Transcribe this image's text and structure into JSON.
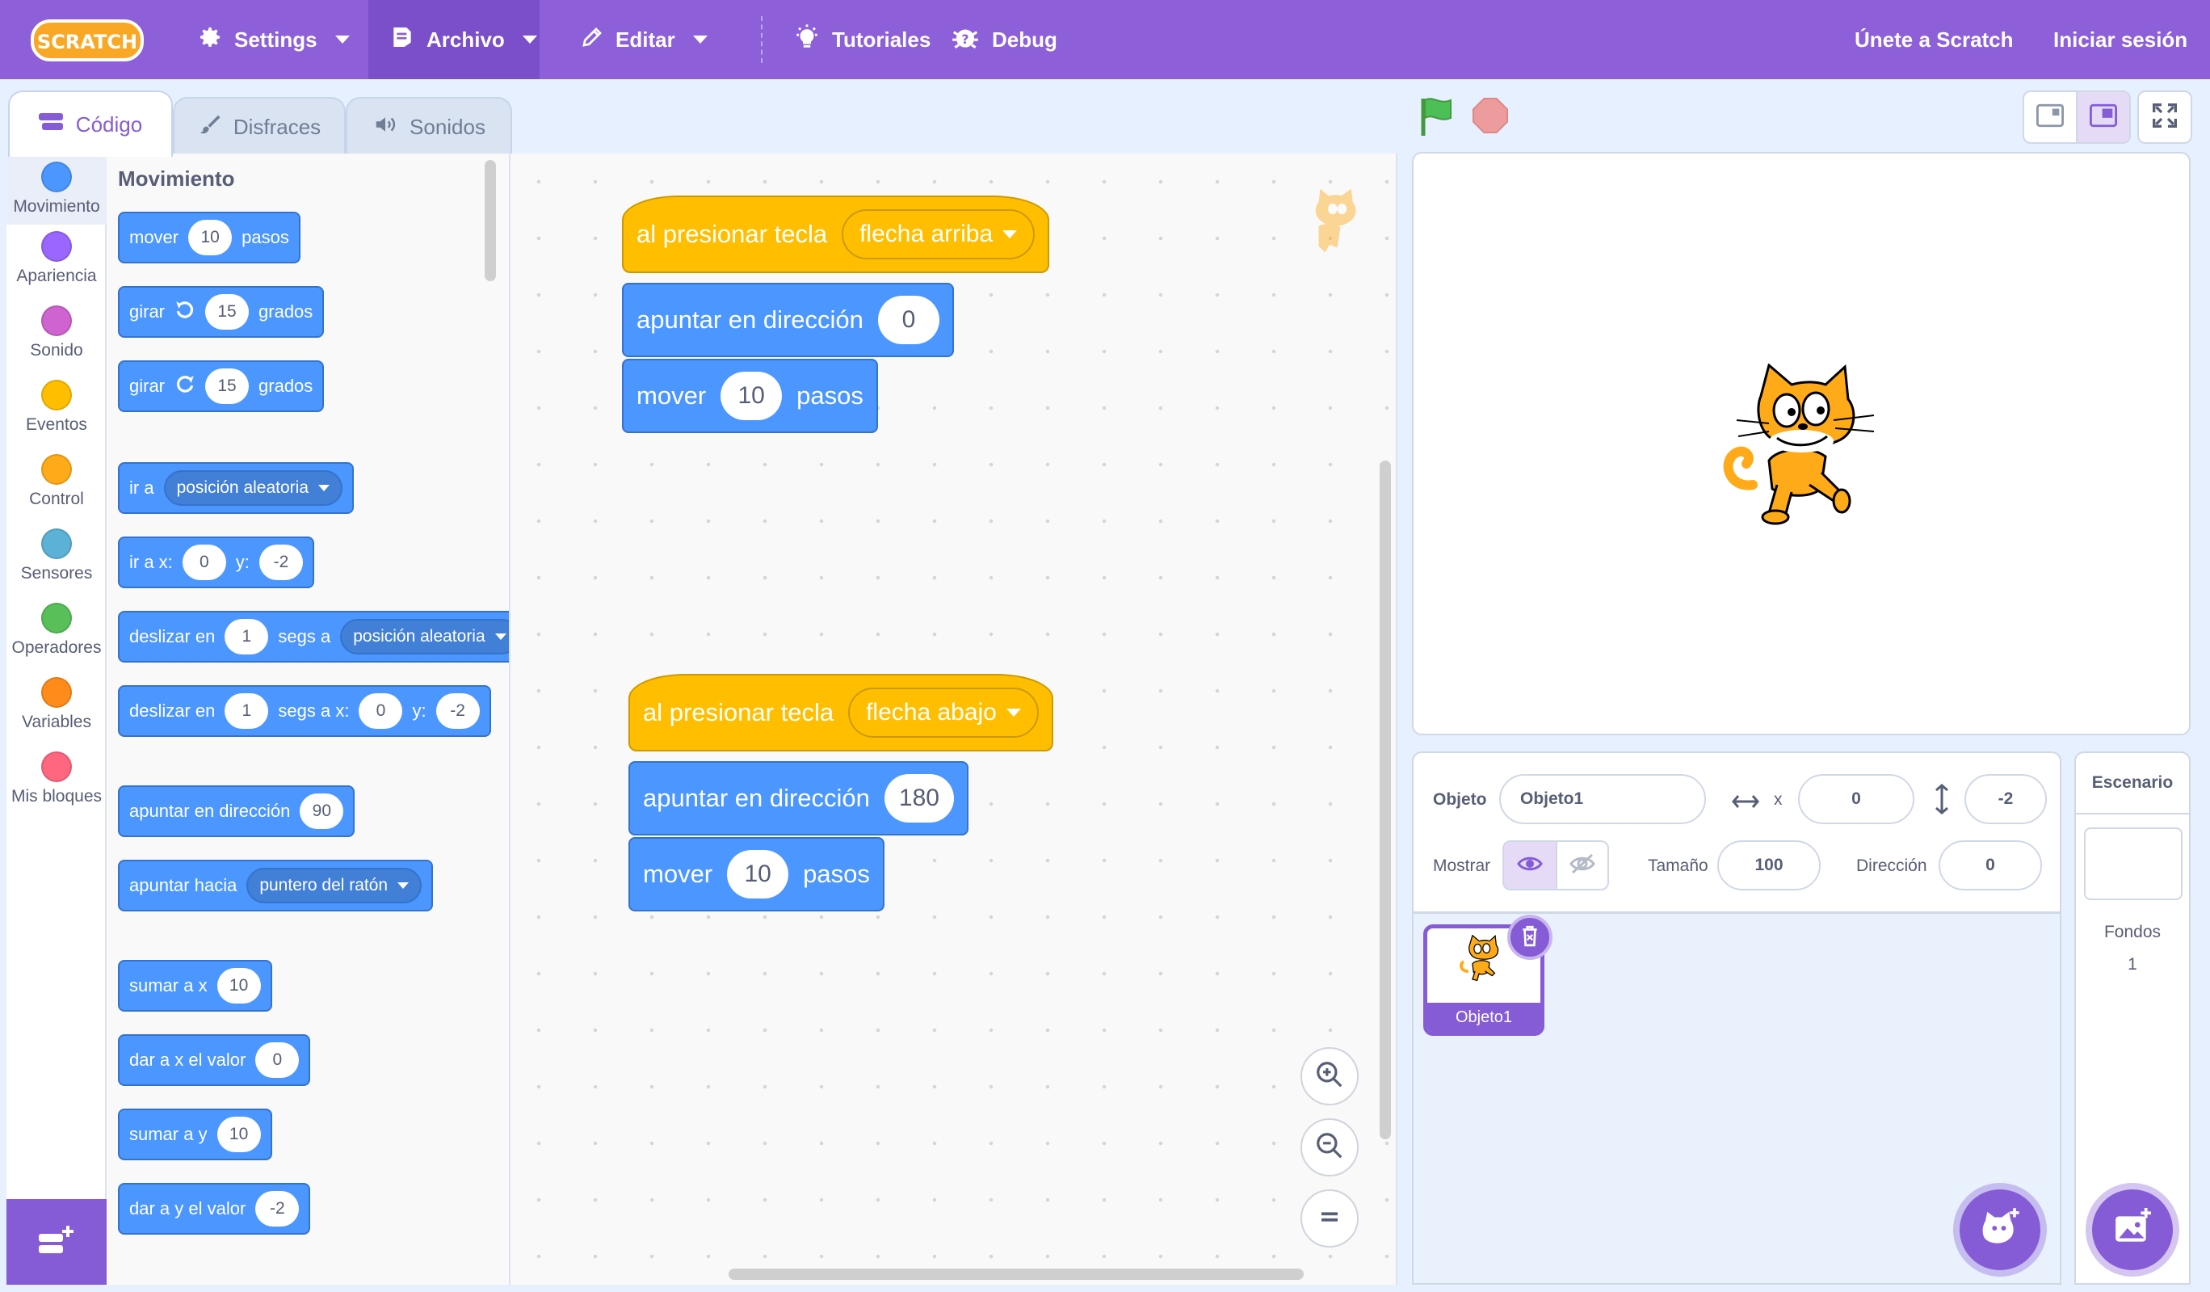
{
  "menu": {
    "logo_text": "SCRATCH",
    "settings": "Settings",
    "file": "Archivo",
    "edit": "Editar",
    "tutorials": "Tutoriales",
    "debug": "Debug",
    "join": "Únete a Scratch",
    "signin": "Iniciar sesión"
  },
  "tabs": {
    "code": "Código",
    "costumes": "Disfraces",
    "sounds": "Sonidos"
  },
  "categories": [
    {
      "label": "Movimiento",
      "color": "#4c97ff"
    },
    {
      "label": "Apariencia",
      "color": "#9966ff"
    },
    {
      "label": "Sonido",
      "color": "#cf63cf"
    },
    {
      "label": "Eventos",
      "color": "#ffbf00"
    },
    {
      "label": "Control",
      "color": "#ffab19"
    },
    {
      "label": "Sensores",
      "color": "#5cb1d6"
    },
    {
      "label": "Operadores",
      "color": "#59c059"
    },
    {
      "label": "Variables",
      "color": "#ff8c1a"
    },
    {
      "label": "Mis bloques",
      "color": "#ff6680"
    }
  ],
  "palette": {
    "heading": "Movimiento",
    "move": {
      "t1": "mover",
      "v": "10",
      "t2": "pasos"
    },
    "turn_right": {
      "t1": "girar",
      "v": "15",
      "t2": "grados"
    },
    "turn_left": {
      "t1": "girar",
      "v": "15",
      "t2": "grados"
    },
    "goto": {
      "t1": "ir a",
      "dd": "posición aleatoria"
    },
    "goto_xy": {
      "t1": "ir a x:",
      "x": "0",
      "t2": "y:",
      "y": "-2"
    },
    "glide": {
      "t1": "deslizar en",
      "v": "1",
      "t2": "segs a",
      "dd": "posición aleatoria"
    },
    "glide_xy": {
      "t1": "deslizar en",
      "v": "1",
      "t2": "segs a x:",
      "x": "0",
      "t3": "y:",
      "y": "-2"
    },
    "point_dir": {
      "t1": "apuntar en dirección",
      "v": "90"
    },
    "point_towards": {
      "t1": "apuntar hacia",
      "dd": "puntero del ratón"
    },
    "change_x": {
      "t1": "sumar a x",
      "v": "10"
    },
    "set_x": {
      "t1": "dar a x el valor",
      "v": "0"
    },
    "change_y": {
      "t1": "sumar a y",
      "v": "10"
    },
    "set_y": {
      "t1": "dar a y el valor",
      "v": "-2"
    }
  },
  "scripts": [
    {
      "hat": {
        "t1": "al presionar tecla",
        "dd": "flecha arriba"
      },
      "point": {
        "t1": "apuntar en dirección",
        "v": "0"
      },
      "move": {
        "t1": "mover",
        "v": "10",
        "t2": "pasos"
      }
    },
    {
      "hat": {
        "t1": "al presionar tecla",
        "dd": "flecha abajo"
      },
      "point": {
        "t1": "apuntar en dirección",
        "v": "180"
      },
      "move": {
        "t1": "mover",
        "v": "10",
        "t2": "pasos"
      }
    }
  ],
  "sprite_info": {
    "sprite_label": "Objeto",
    "sprite_name": "Objeto1",
    "x_label": "x",
    "x_value": "0",
    "y_label": "y",
    "y_value": "-2",
    "show_label": "Mostrar",
    "size_label": "Tamaño",
    "size_value": "100",
    "direction_label": "Dirección",
    "direction_value": "0"
  },
  "sprites": [
    {
      "name": "Objeto1"
    }
  ],
  "stage_pane": {
    "title": "Escenario",
    "backdrops_label": "Fondos",
    "backdrops_count": "1"
  },
  "colors": {
    "menu_bg": "#8d5fd8",
    "accent": "#855cd6",
    "motion": "#4c97ff",
    "events": "#ffbf00"
  }
}
